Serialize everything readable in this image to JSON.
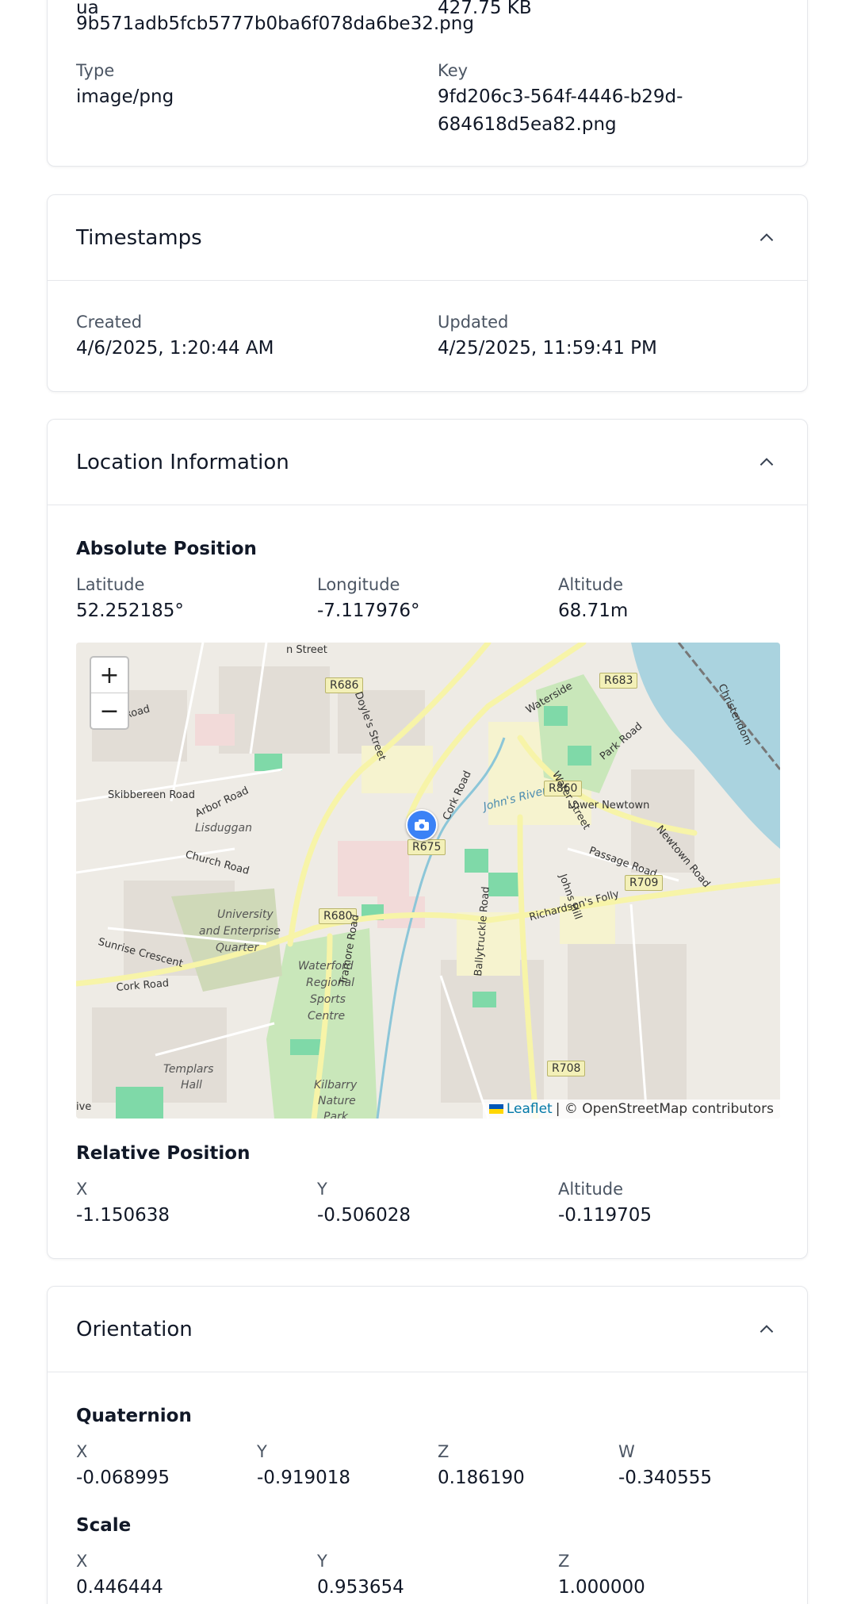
{
  "file_card": {
    "partial_top_label": "ua",
    "partial_top_right": "427.75 KB",
    "filename": "9b571adb5fcb5777b0ba6f078da6be32.png",
    "type_label": "Type",
    "type_value": "image/png",
    "key_label": "Key",
    "key_value_line1": "9fd206c3-564f-4446-b29d-",
    "key_value_line2": "684618d5ea82.png"
  },
  "timestamps": {
    "title": "Timestamps",
    "created_label": "Created",
    "created_value": "4/6/2025, 1:20:44 AM",
    "updated_label": "Updated",
    "updated_value": "4/25/2025, 11:59:41 PM"
  },
  "location": {
    "title": "Location Information",
    "absolute_title": "Absolute Position",
    "latitude_label": "Latitude",
    "latitude_value": "52.252185°",
    "longitude_label": "Longitude",
    "longitude_value": "-7.117976°",
    "altitude_label": "Altitude",
    "altitude_value": "68.71m",
    "relative_title": "Relative Position",
    "rel_x_label": "X",
    "rel_x_value": "-1.150638",
    "rel_y_label": "Y",
    "rel_y_value": "-0.506028",
    "rel_alt_label": "Altitude",
    "rel_alt_value": "-0.119705",
    "map": {
      "zoom_in": "+",
      "zoom_out": "−",
      "attribution_link": "Leaflet",
      "attribution_text": "| © OpenStreetMap contributors",
      "labels": {
        "street_top": "n Street",
        "r686": "R686",
        "doyles": "Doyle's Street",
        "r683": "R683",
        "christendom": "Christendom",
        "road_tl": "y Road",
        "waterside": "Waterside",
        "skibbereen": "Skibbereen Road",
        "arbor": "Arbor Road",
        "lisduggan": "Lisduggan",
        "church": "Church Road",
        "cork_road_n": "Cork Road",
        "johns_river": "John's River",
        "r860": "R860",
        "water_street": "Water Street",
        "park_road": "Park Road",
        "lower_newtown": "Lower Newtown",
        "newtown_road": "Newtown Road",
        "r675": "R675",
        "passage_road": "Passage Road",
        "johns_hill": "Johns Hill",
        "r709": "R709",
        "university1": "University",
        "university2": "and Enterprise",
        "university3": "Quarter",
        "sunrise": "Sunrise Crescent",
        "r680": "R680",
        "richardsons": "Richardson's Folly",
        "waterford1": "Waterford",
        "waterford2": "Regional",
        "waterford3": "Sports",
        "waterford4": "Centre",
        "cork_road_w": "Cork Road",
        "tramore": "Tramore Road",
        "ballytruckle": "Ballytruckle Road",
        "r708": "R708",
        "templars1": "Templars",
        "templars2": "Hall",
        "kilbarry1": "Kilbarry",
        "kilbarry2": "Nature",
        "kilbarry3": "Park",
        "ive": "ive"
      }
    }
  },
  "orientation": {
    "title": "Orientation",
    "quaternion_title": "Quaternion",
    "qx_label": "X",
    "qx_value": "-0.068995",
    "qy_label": "Y",
    "qy_value": "-0.919018",
    "qz_label": "Z",
    "qz_value": "0.186190",
    "qw_label": "W",
    "qw_value": "-0.340555",
    "scale_title": "Scale",
    "sx_label": "X",
    "sx_value": "0.446444",
    "sy_label": "Y",
    "sy_value": "0.953654",
    "sz_label": "Z",
    "sz_value": "1.000000"
  },
  "colors": {
    "border": "#e5e7eb",
    "label": "#4b5563",
    "marker": "#3b82f6",
    "map_link": "#0078a8"
  }
}
